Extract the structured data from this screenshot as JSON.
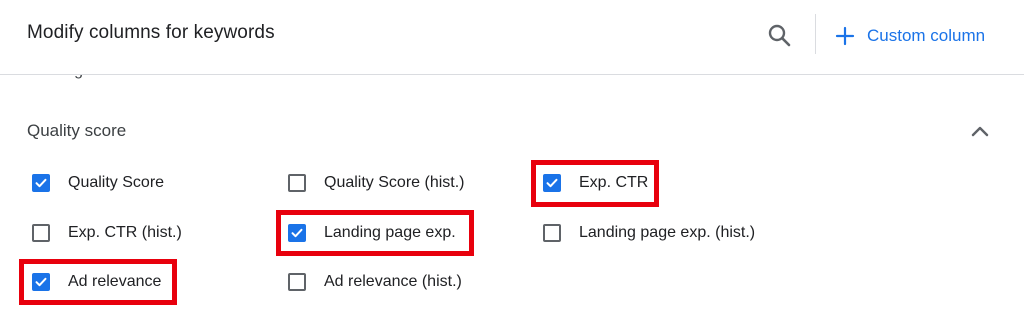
{
  "header": {
    "title": "Modify columns for keywords",
    "search_icon": "search-icon",
    "custom_column_icon": "plus-icon",
    "custom_column_label": "Custom column"
  },
  "previous_section": {
    "title": "Message details",
    "icon": "chevron-down-icon"
  },
  "section": {
    "title": "Quality score",
    "collapse_icon": "chevron-up-icon",
    "options": [
      {
        "label": "Quality Score",
        "checked": true,
        "highlighted": false
      },
      {
        "label": "Quality Score (hist.)",
        "checked": false,
        "highlighted": false
      },
      {
        "label": "Exp. CTR",
        "checked": true,
        "highlighted": true
      },
      {
        "label": "Exp. CTR (hist.)",
        "checked": false,
        "highlighted": false
      },
      {
        "label": "Landing page exp.",
        "checked": true,
        "highlighted": true
      },
      {
        "label": "Landing page exp. (hist.)",
        "checked": false,
        "highlighted": false
      },
      {
        "label": "Ad relevance",
        "checked": true,
        "highlighted": true
      },
      {
        "label": "Ad relevance (hist.)",
        "checked": false,
        "highlighted": false
      }
    ]
  },
  "colors": {
    "accent": "#1a73e8",
    "highlight": "#e8000d",
    "text": "#202124",
    "unchecked_border": "#5f6368"
  }
}
